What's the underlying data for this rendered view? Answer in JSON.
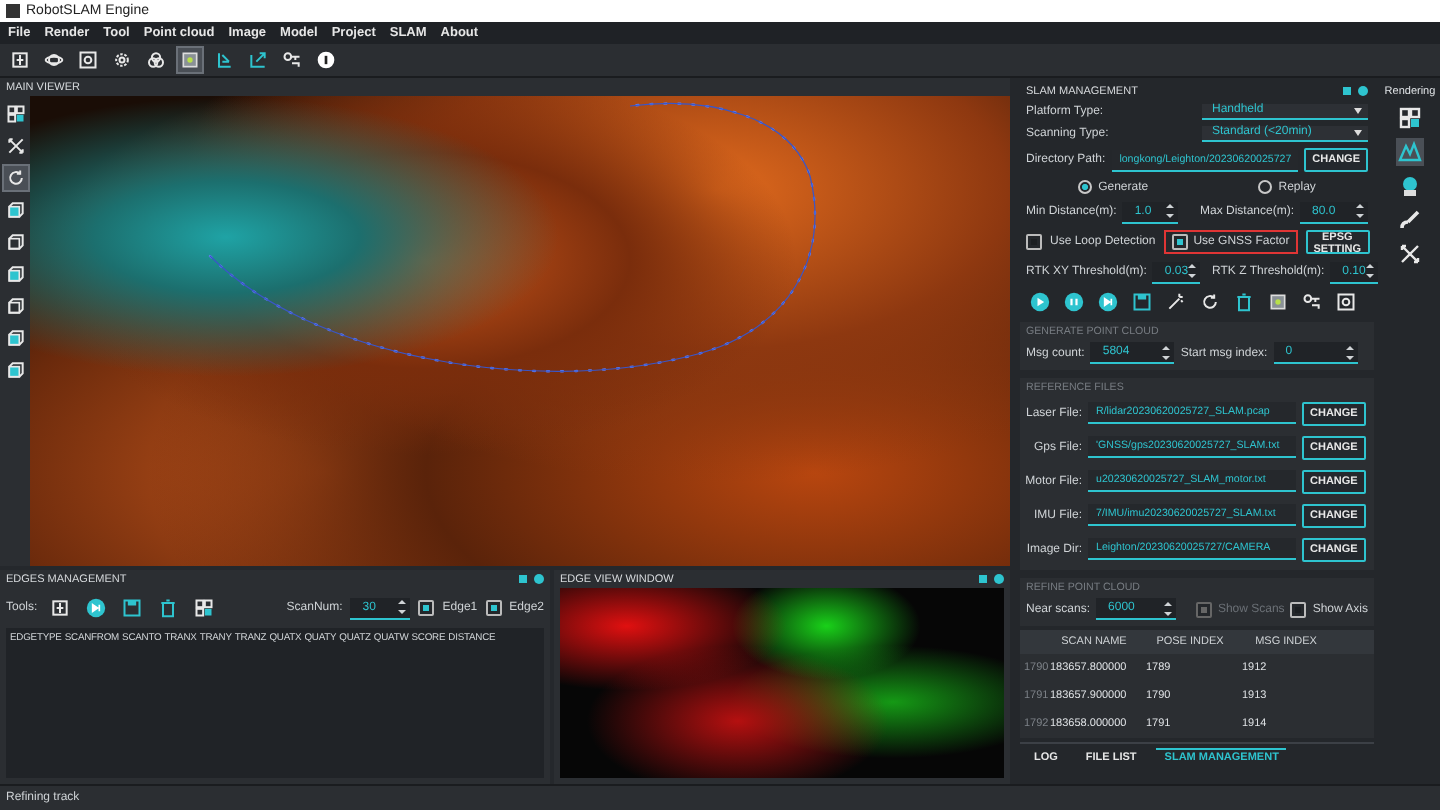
{
  "window": {
    "title": "RobotSLAM Engine"
  },
  "menu": [
    "File",
    "Render",
    "Tool",
    "Point cloud",
    "Image",
    "Model",
    "Project",
    "SLAM",
    "About"
  ],
  "toolbar": [
    {
      "kind": "frame",
      "selected": false
    },
    {
      "kind": "orbit",
      "selected": false
    },
    {
      "kind": "zoom",
      "selected": false
    },
    {
      "kind": "gear",
      "selected": false
    },
    {
      "kind": "circles",
      "selected": false
    },
    {
      "kind": "screen",
      "selected": true
    },
    {
      "kind": "import",
      "selected": false
    },
    {
      "kind": "export",
      "selected": false
    },
    {
      "kind": "key",
      "selected": false
    },
    {
      "kind": "info",
      "selected": false
    }
  ],
  "main_viewer": {
    "title": "MAIN VIEWER",
    "side_tools": [
      {
        "kind": "grid",
        "selected": false
      },
      {
        "kind": "cross",
        "selected": false
      },
      {
        "kind": "rotate",
        "selected": true
      },
      {
        "kind": "cube-front",
        "selected": false
      },
      {
        "kind": "cube",
        "selected": false
      },
      {
        "kind": "cube-left",
        "selected": false
      },
      {
        "kind": "cube",
        "selected": false
      },
      {
        "kind": "cube-right",
        "selected": false
      },
      {
        "kind": "cube-fill",
        "selected": false
      }
    ]
  },
  "edges": {
    "title": "EDGES MANAGEMENT",
    "tools_label": "Tools:",
    "scan_num_label": "ScanNum:",
    "scan_num": "30",
    "checks": [
      {
        "label": "Edge1",
        "checked": true
      },
      {
        "label": "Edge2",
        "checked": true
      }
    ],
    "columns": [
      "EDGETYPE",
      "SCANFROM",
      "SCANTO",
      "TRANX",
      "TRANY",
      "TRANZ",
      "QUATX",
      "QUATY",
      "QUATZ",
      "QUATW",
      "SCORE",
      "DISTANCE"
    ]
  },
  "edge_view": {
    "title": "EDGE VIEW WINDOW"
  },
  "slam": {
    "title": "SLAM MANAGEMENT",
    "platform_label": "Platform Type:",
    "platform": "Handheld",
    "scanning_label": "Scanning Type:",
    "scanning": "Standard  (<20min)",
    "dir_label": "Directory Path:",
    "dir": "longkong/Leighton/20230620025727",
    "change": "CHANGE",
    "modes": [
      {
        "label": "Generate",
        "selected": true
      },
      {
        "label": "Replay",
        "selected": false
      }
    ],
    "min_label": "Min Distance(m):",
    "min": "1.0",
    "max_label": "Max Distance(m):",
    "max": "80.0",
    "loop": {
      "label": "Use Loop Detection",
      "checked": false
    },
    "gnss": {
      "label": "Use GNSS Factor",
      "checked": true
    },
    "epsg": "EPSG SETTING",
    "rtkxy_label": "RTK XY Threshold(m):",
    "rtkxy": "0.03",
    "rtkz_label": "RTK Z Threshold(m):",
    "rtkz": "0.10",
    "actions": [
      {
        "kind": "play"
      },
      {
        "kind": "pause"
      },
      {
        "kind": "skip"
      },
      {
        "kind": "save"
      },
      {
        "kind": "wand"
      },
      {
        "kind": "undo"
      },
      {
        "kind": "trash"
      },
      {
        "kind": "monitor"
      },
      {
        "kind": "tree"
      },
      {
        "kind": "image"
      }
    ],
    "generate": {
      "title": "GENERATE POINT CLOUD",
      "count_label": "Msg count:",
      "count": "5804",
      "start_label": "Start msg index:",
      "start": "0"
    },
    "reference": {
      "title": "REFERENCE FILES",
      "files": [
        {
          "label": "Laser File:",
          "value": "R/lidar20230620025727_SLAM.pcap",
          "button": "CHANGE"
        },
        {
          "label": "Gps File:",
          "value": "'GNSS/gps20230620025727_SLAM.txt",
          "button": "CHANGE"
        },
        {
          "label": "Motor File:",
          "value": "u20230620025727_SLAM_motor.txt",
          "button": "CHANGE"
        },
        {
          "label": "IMU File:",
          "value": "7/IMU/imu20230620025727_SLAM.txt",
          "button": "CHANGE"
        },
        {
          "label": "Image Dir:",
          "value": "Leighton/20230620025727/CAMERA",
          "button": "CHANGE"
        }
      ]
    },
    "refine": {
      "title": "REFINE POINT CLOUD",
      "near_label": "Near scans:",
      "near": "6000",
      "show_scans": {
        "label": "Show Scans",
        "checked": true,
        "disabled": true
      },
      "show_axis": {
        "label": "Show Axis",
        "checked": false,
        "disabled": false
      }
    },
    "table": {
      "columns": [
        "SCAN NAME",
        "POSE INDEX",
        "MSG INDEX"
      ],
      "rows": [
        {
          "index": "1790",
          "cells": [
            "183657.800000",
            "1789",
            "1912"
          ]
        },
        {
          "index": "1791",
          "cells": [
            "183657.900000",
            "1790",
            "1913"
          ]
        },
        {
          "index": "1792",
          "cells": [
            "183658.000000",
            "1791",
            "1914"
          ]
        }
      ]
    },
    "tabs": [
      {
        "label": "LOG",
        "selected": false
      },
      {
        "label": "FILE LIST",
        "selected": false
      },
      {
        "label": "SLAM MANAGEMENT",
        "selected": true
      }
    ]
  },
  "rendering": {
    "title": "Rendering",
    "tools": [
      {
        "kind": "layers",
        "selected": false
      },
      {
        "kind": "mountain",
        "selected": true
      },
      {
        "kind": "robot",
        "selected": false
      },
      {
        "kind": "brush",
        "selected": false
      },
      {
        "kind": "axes",
        "selected": false
      }
    ]
  },
  "status_bar": "Refining track"
}
